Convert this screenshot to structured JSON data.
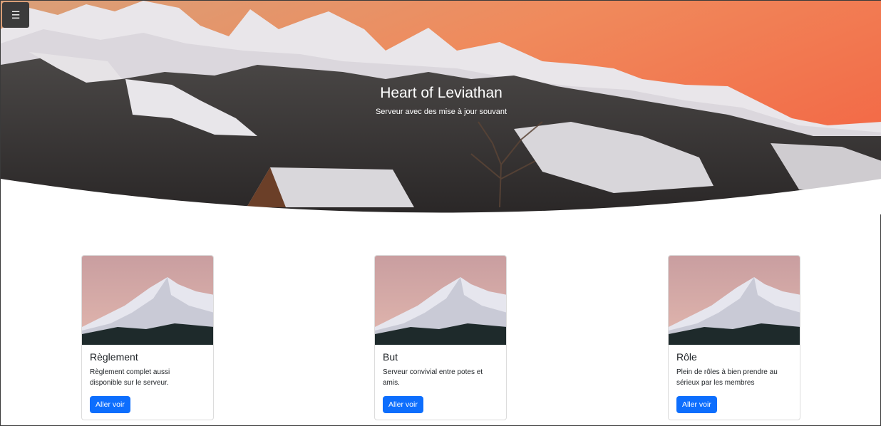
{
  "menu": {
    "toggle_label": "☰"
  },
  "hero": {
    "title": "Heart of Leviathan",
    "subtitle": "Serveur avec des mise à jour souvant"
  },
  "cards": [
    {
      "title": "Règlement",
      "text": "Règlement complet aussi disponible sur le serveur.",
      "button_label": "Aller voir"
    },
    {
      "title": "But",
      "text": "Serveur convivial entre potes et amis.",
      "button_label": "Aller voir"
    },
    {
      "title": "Rôle",
      "text": "Plein de rôles à bien prendre au sérieux par les membres",
      "button_label": "Aller voir"
    }
  ],
  "colors": {
    "primary_button": "#0d6efd",
    "menu_button": "#3b3b3b"
  }
}
